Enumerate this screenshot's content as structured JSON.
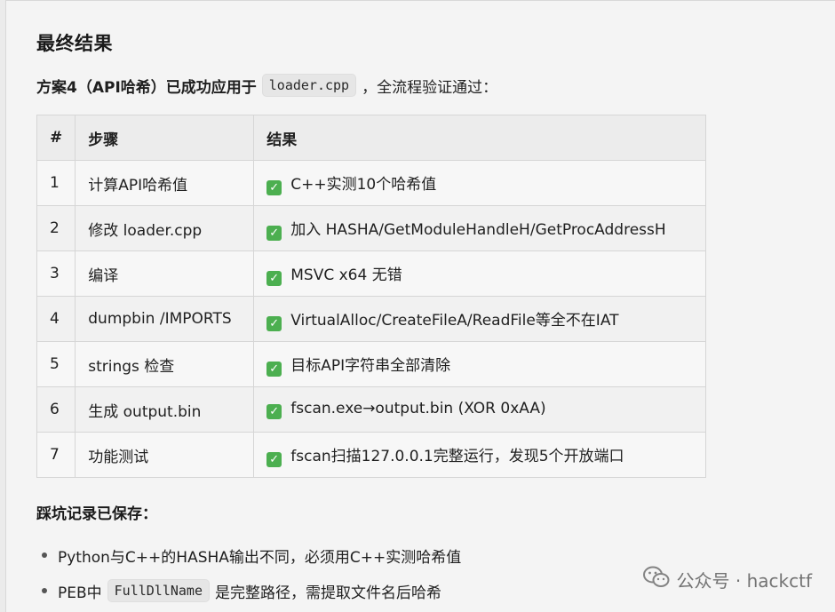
{
  "section_title": "最终结果",
  "intro": {
    "bold_text": "方案4（API哈希）已成功应用于",
    "code": "loader.cpp",
    "rest": "，全流程验证通过："
  },
  "table": {
    "headers": [
      "#",
      "步骤",
      "结果"
    ],
    "rows": [
      {
        "num": "1",
        "step": "计算API哈希值",
        "result": "C++实测10个哈希值"
      },
      {
        "num": "2",
        "step": "修改 loader.cpp",
        "result": "加入 HASHA/GetModuleHandleH/GetProcAddressH"
      },
      {
        "num": "3",
        "step": "编译",
        "result": "MSVC x64 无错"
      },
      {
        "num": "4",
        "step": "dumpbin /IMPORTS",
        "result": "VirtualAlloc/CreateFileA/ReadFile等全不在IAT"
      },
      {
        "num": "5",
        "step": "strings 检查",
        "result": "目标API字符串全部清除"
      },
      {
        "num": "6",
        "step": "生成 output.bin",
        "result": "fscan.exe→output.bin (XOR 0xAA)"
      },
      {
        "num": "7",
        "step": "功能测试",
        "result": "fscan扫描127.0.0.1完整运行，发现5个开放端口"
      }
    ]
  },
  "check_icon": "check-box-icon",
  "pitfalls_title": "踩坑记录已保存：",
  "pitfalls": {
    "item1": "Python与C++的HASHA输出不同，必须用C++实测哈希值",
    "item2_prefix": "PEB中",
    "item2_code": "FullDllName",
    "item2_suffix": "是完整路径，需提取文件名后哈希"
  },
  "watermark": {
    "text": "公众号 · hackctf",
    "icon": "wechat-icon"
  },
  "colors": {
    "check_green": "#4caf50",
    "background": "#f4f4f4"
  }
}
